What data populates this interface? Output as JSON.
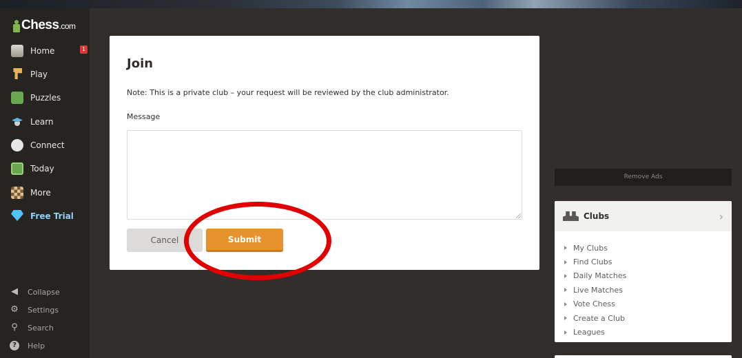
{
  "logo": {
    "text": "Chess",
    "suffix": ".com"
  },
  "sidebar": {
    "items": [
      {
        "label": "Home",
        "icon": "home-icon"
      },
      {
        "label": "Play",
        "icon": "play-icon"
      },
      {
        "label": "Puzzles",
        "icon": "puzzles-icon"
      },
      {
        "label": "Learn",
        "icon": "learn-icon"
      },
      {
        "label": "Connect",
        "icon": "connect-icon"
      },
      {
        "label": "Today",
        "icon": "today-icon"
      },
      {
        "label": "More",
        "icon": "more-icon"
      },
      {
        "label": "Free Trial",
        "icon": "diamond-icon"
      }
    ],
    "home_badge": "1",
    "bottom": [
      {
        "label": "Collapse",
        "icon": "collapse-icon"
      },
      {
        "label": "Settings",
        "icon": "gear-icon"
      },
      {
        "label": "Search",
        "icon": "search-icon"
      },
      {
        "label": "Help",
        "icon": "help-icon"
      }
    ]
  },
  "modal": {
    "title": "Join",
    "note": "Note: This is a private club – your request will be reviewed by the club administrator.",
    "message_label": "Message",
    "message_value": "",
    "cancel_label": "Cancel",
    "submit_label": "Submit"
  },
  "right": {
    "remove_ads": "Remove Ads",
    "clubs": {
      "title": "Clubs",
      "items": [
        "My Clubs",
        "Find Clubs",
        "Daily Matches",
        "Live Matches",
        "Vote Chess",
        "Create a Club",
        "Leagues"
      ]
    }
  },
  "colors": {
    "background": "#312e2b",
    "sidebar": "#262421",
    "submit": "#e8922d",
    "annotation": "#e00000",
    "accent": "#81b64c"
  }
}
